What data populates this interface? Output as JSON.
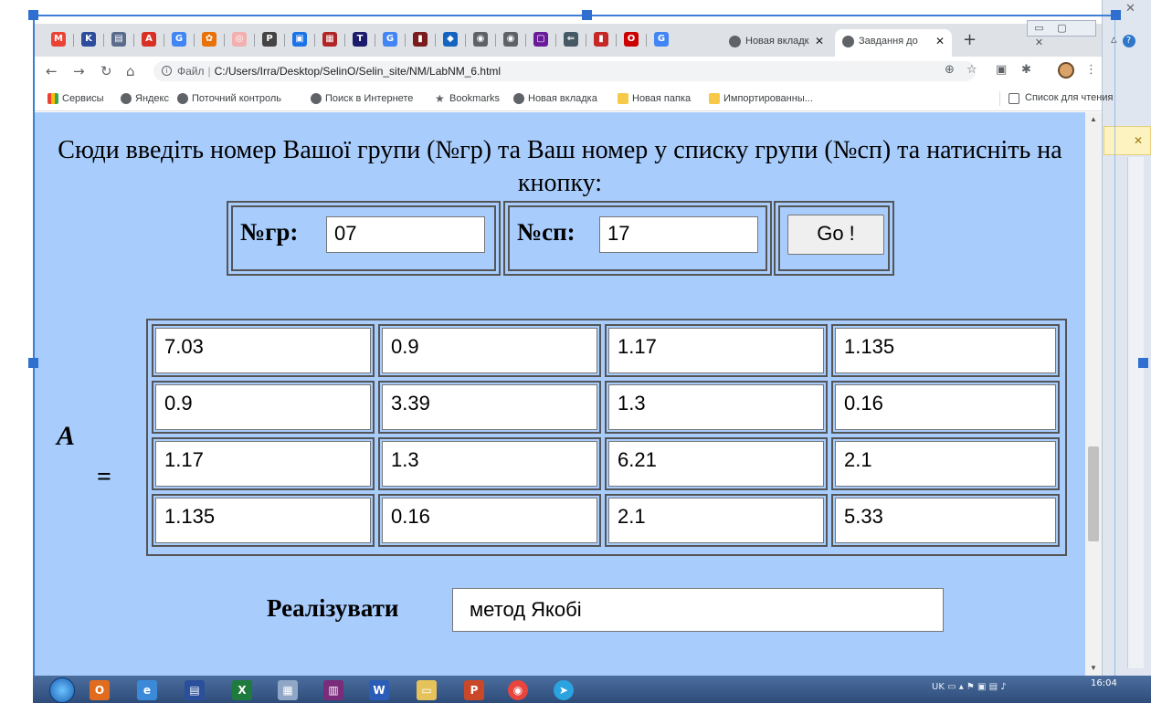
{
  "browser": {
    "tabs": [
      {
        "label": "Новая вкладк",
        "active": false
      },
      {
        "label": "Завдання до",
        "active": true
      }
    ],
    "pinned_favicons": [
      "gmail-icon",
      "k-icon",
      "doc-icon",
      "a-icon",
      "google-icon",
      "paw-icon",
      "circle-icon",
      "pkp-icon",
      "box-icon",
      "image-icon",
      "t-icon",
      "g-red-icon",
      "film-icon",
      "blue-icon",
      "globe-icon",
      "globe-icon",
      "purple-box-icon",
      "arrow-icon",
      "chart-icon",
      "opera-icon",
      "google-icon"
    ],
    "new_tab": "+",
    "window_controls": [
      "▭",
      "▢",
      "✕"
    ],
    "address": {
      "scheme": "Файл",
      "url": "C:/Users/Irra/Desktop/SelinO/Selin_site/NM/LabNM_6.html"
    },
    "bookmarks": [
      "Сервисы",
      "Яндекс",
      "Поточний контроль",
      "Поиск в Интернете",
      "Bookmarks",
      "Новая вкладка",
      "Новая папка",
      "Импортированны..."
    ],
    "reading_list": "Список для чтения"
  },
  "page": {
    "instructions": "Сюди введіть номер Вашої групи (№гр) та Ваш номер у списку групи (№сп) та натисніть на кнопку:",
    "group_label": "№гр:",
    "group_value": "07",
    "list_label": "№сп:",
    "list_value": "17",
    "go_button": "Go !",
    "matrix_symbol": "A",
    "equals": "=",
    "matrix": [
      [
        "7.03",
        "0.9",
        "1.17",
        "1.135"
      ],
      [
        "0.9",
        "3.39",
        "1.3",
        "0.16"
      ],
      [
        "1.17",
        "1.3",
        "6.21",
        "2.1"
      ],
      [
        "1.135",
        "0.16",
        "2.1",
        "5.33"
      ]
    ],
    "implement_label": "Реалізувати",
    "method_value": "метод Якобі"
  },
  "taskbar": {
    "apps": [
      "start-icon",
      "outlook-icon",
      "ie-icon",
      "save-icon",
      "excel-icon",
      "calc-icon",
      "archive-icon",
      "word-icon",
      "folder-icon",
      "powerpoint-icon",
      "chrome-icon",
      "telegram-icon"
    ],
    "tray_lang": "UK",
    "clock": "16:04"
  },
  "colors": {
    "page_bg": "#a8cdfd",
    "selection": "#3d7fd6"
  }
}
